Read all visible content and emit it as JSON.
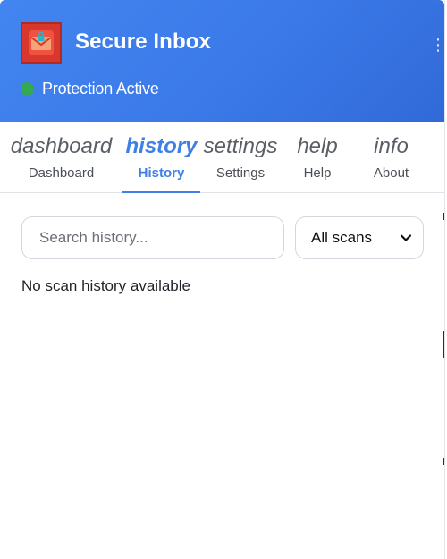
{
  "header": {
    "title": "Secure Inbox",
    "status_text": "Protection Active",
    "status_color": "#34a853",
    "gradient_colors": [
      "#4285f0",
      "#316ad8"
    ],
    "logo_icon": "envelope-lock-icon",
    "logo_color": "#d7372c"
  },
  "tabs": [
    {
      "icon_text": "dashboard",
      "label": "Dashboard",
      "active": false
    },
    {
      "icon_text": "history",
      "label": "History",
      "active": true
    },
    {
      "icon_text": "settings",
      "label": "Settings",
      "active": false
    },
    {
      "icon_text": "help",
      "label": "Help",
      "active": false
    },
    {
      "icon_text": "info",
      "label": "About",
      "active": false
    }
  ],
  "accent_color": "#3f80e6",
  "history": {
    "search_placeholder": "Search history...",
    "search_value": "",
    "filter_selected": "All scans",
    "empty_message": "No scan history available"
  }
}
